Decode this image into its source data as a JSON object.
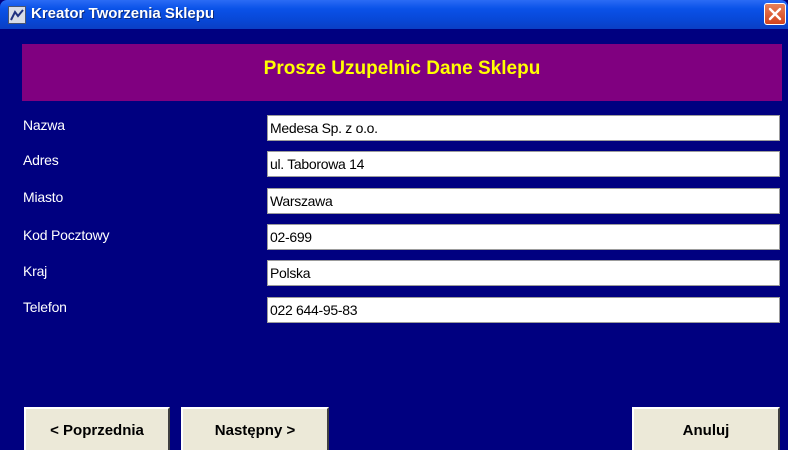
{
  "window": {
    "title": "Kreator Tworzenia Sklepu"
  },
  "header": {
    "title": "Prosze Uzupelnic Dane Sklepu"
  },
  "fields": [
    {
      "label": "Nazwa",
      "value": "Medesa Sp. z o.o."
    },
    {
      "label": "Adres",
      "value": "ul. Taborowa 14"
    },
    {
      "label": "Miasto",
      "value": "Warszawa"
    },
    {
      "label": "Kod Pocztowy",
      "value": "02-699"
    },
    {
      "label": "Kraj",
      "value": "Polska"
    },
    {
      "label": "Telefon",
      "value": "022 644-95-83"
    }
  ],
  "buttons": {
    "previous": "< Poprzednia",
    "next": "Następny >",
    "cancel": "Anuluj"
  },
  "icons": {
    "app": "app-icon",
    "close": "close-icon"
  },
  "colors": {
    "background": "#000080",
    "header_band": "#800080",
    "header_text": "#ffff00",
    "titlebar": "#0a52e8"
  }
}
